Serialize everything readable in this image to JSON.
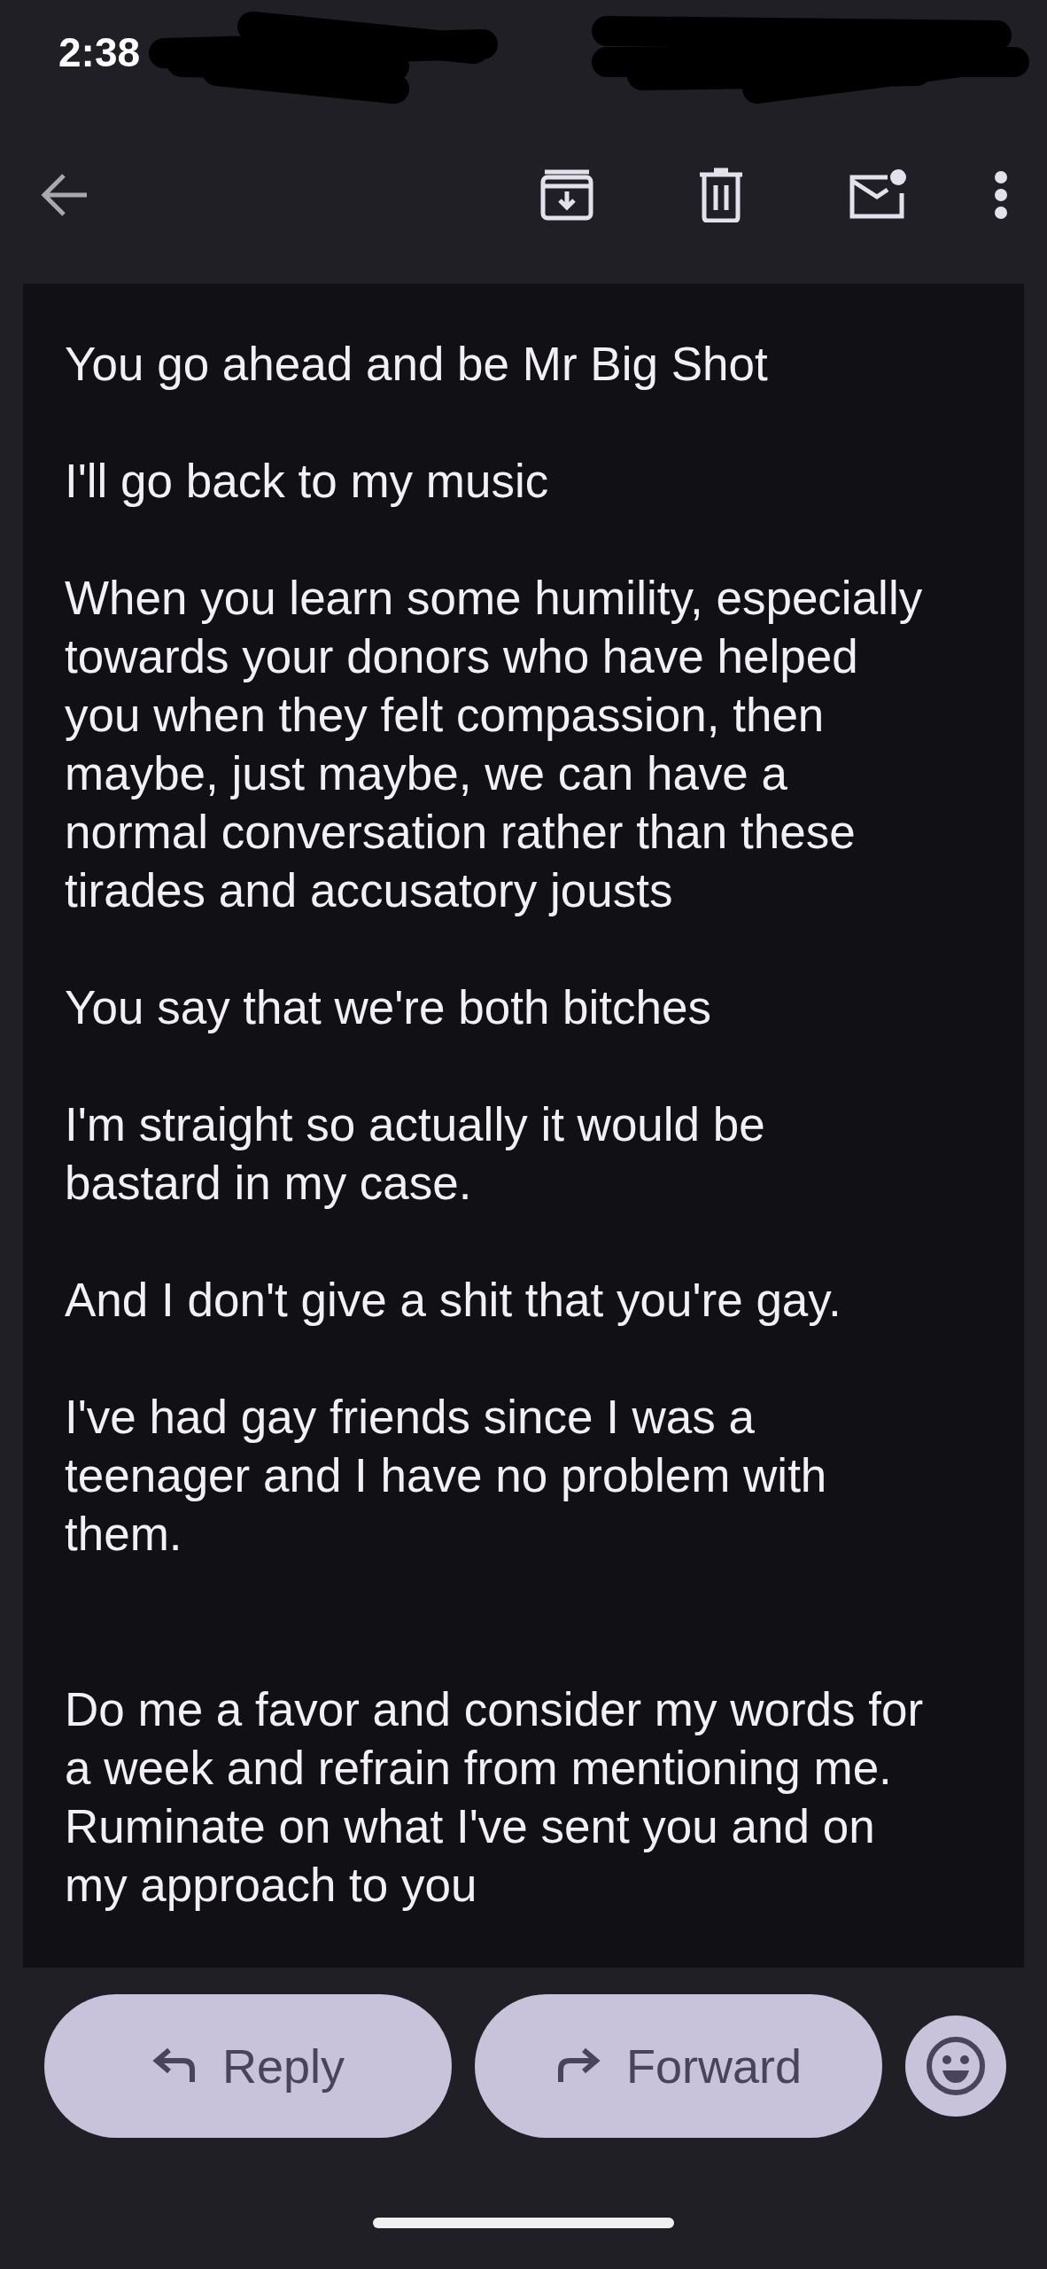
{
  "status_bar": {
    "time": "2:38"
  },
  "message": {
    "paragraphs": [
      {
        "lines": [
          "You go ahead and be Mr Big Shot"
        ]
      },
      {
        "lines": [
          "I'll go back to my music"
        ]
      },
      {
        "lines": [
          "When you learn some humility, especially",
          "towards your donors who have helped",
          "you when they felt compassion, then",
          "maybe, just maybe, we can have a",
          "normal conversation rather than these",
          "tirades and accusatory jousts"
        ]
      },
      {
        "lines": [
          "You say that we're both bitches"
        ]
      },
      {
        "lines": [
          "I'm straight so actually it would be",
          "bastard in my case."
        ]
      },
      {
        "lines": [
          "And I don't give a shit that you're gay."
        ]
      },
      {
        "lines": [
          "I've had gay friends since I was a",
          "teenager and I have no problem with",
          "them."
        ]
      },
      {
        "lines": [
          "Do me a favor and consider my words for",
          "a week and refrain from mentioning me.",
          "Ruminate on what I've sent you and on",
          "my approach to you"
        ]
      }
    ]
  },
  "actions": [
    {
      "kind": "reply",
      "label": "Reply"
    },
    {
      "kind": "forward",
      "label": "Forward"
    }
  ]
}
